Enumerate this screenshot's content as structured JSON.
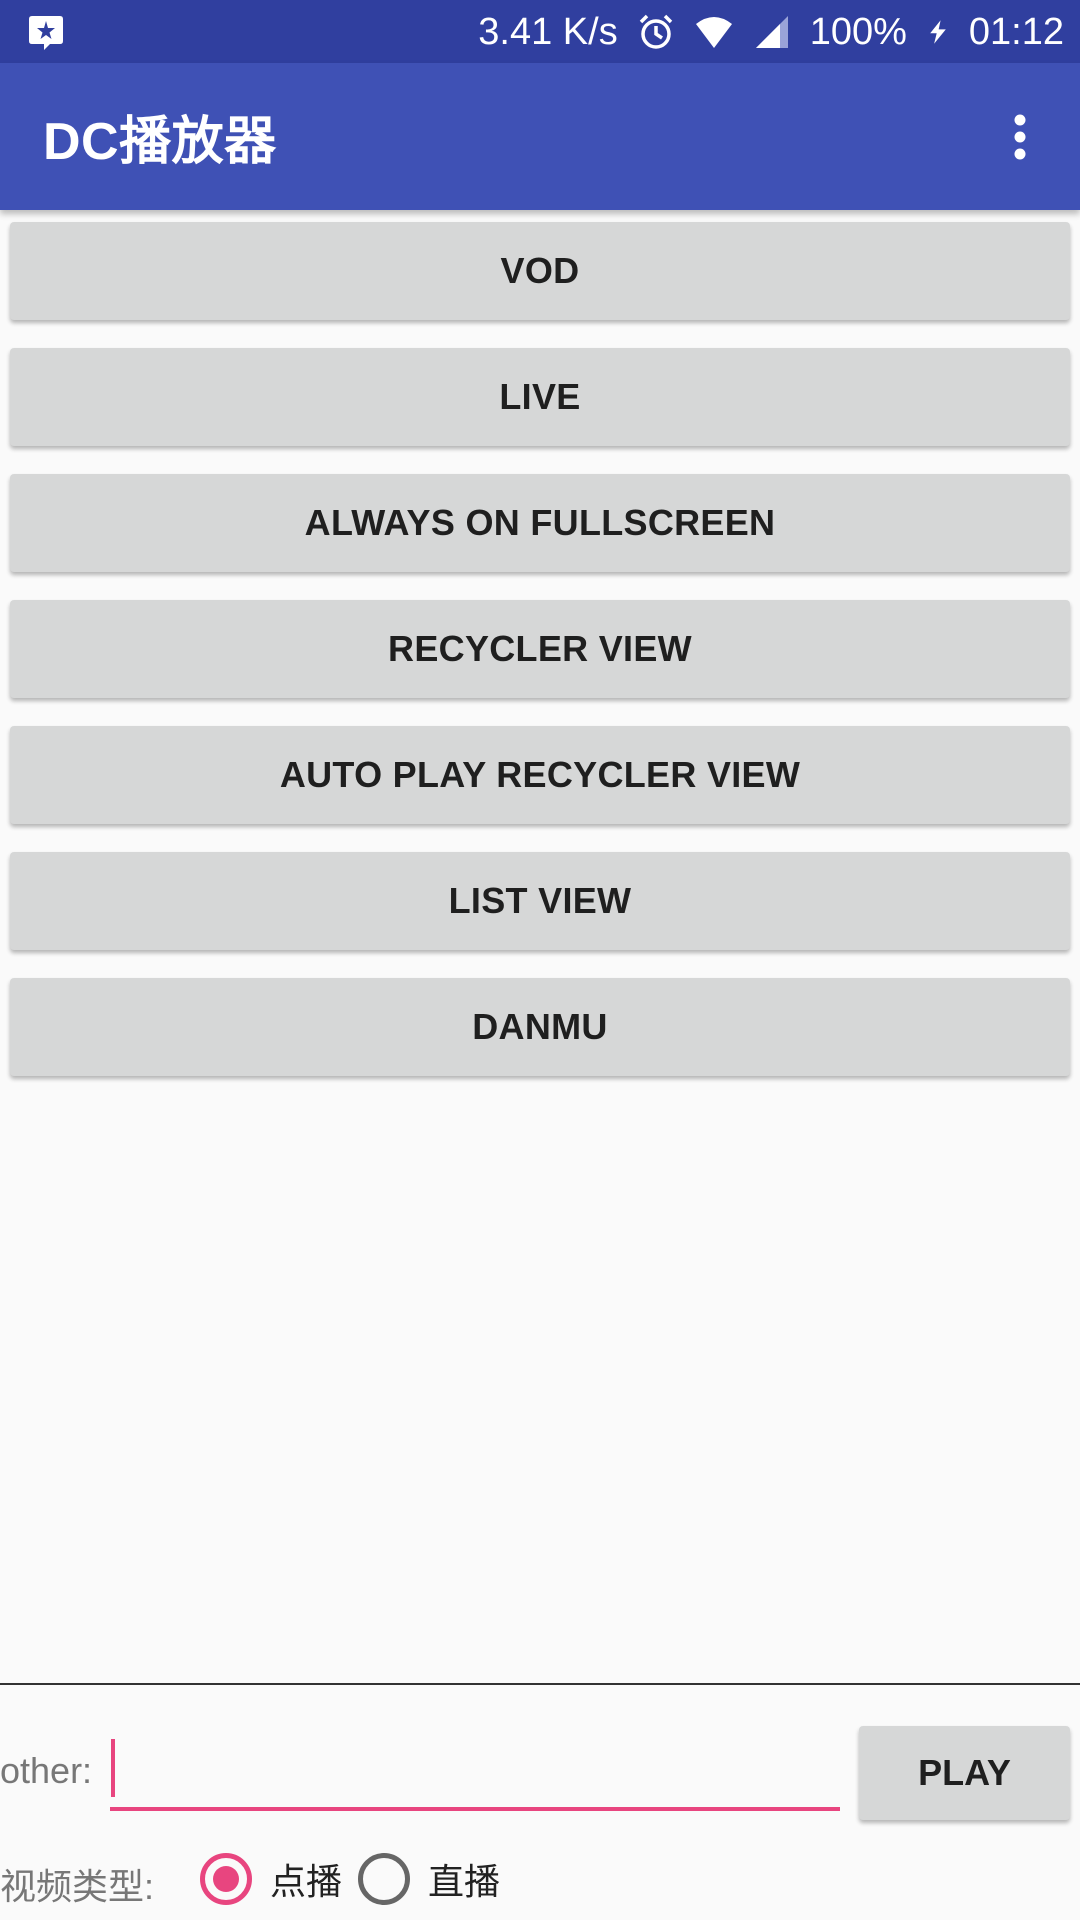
{
  "status_bar": {
    "net_speed": "3.41 K/s",
    "battery": "100%",
    "time": "01:12"
  },
  "app_bar": {
    "title": "DC播放器"
  },
  "buttons": [
    {
      "label": "VOD"
    },
    {
      "label": "LIVE"
    },
    {
      "label": "ALWAYS ON FULLSCREEN"
    },
    {
      "label": "RECYCLER VIEW"
    },
    {
      "label": "AUTO PLAY RECYCLER VIEW"
    },
    {
      "label": "LIST VIEW"
    },
    {
      "label": "DANMU"
    }
  ],
  "bottom": {
    "other_label": "other:",
    "other_value": "",
    "play_label": "PLAY",
    "type_label": "视频类型:",
    "radio_vod": "点播",
    "radio_live": "直播",
    "selected": "点播"
  },
  "colors": {
    "status_bar": "#303f9f",
    "app_bar": "#3f51b5",
    "accent": "#e8457f",
    "button_bg": "#d6d7d7"
  }
}
